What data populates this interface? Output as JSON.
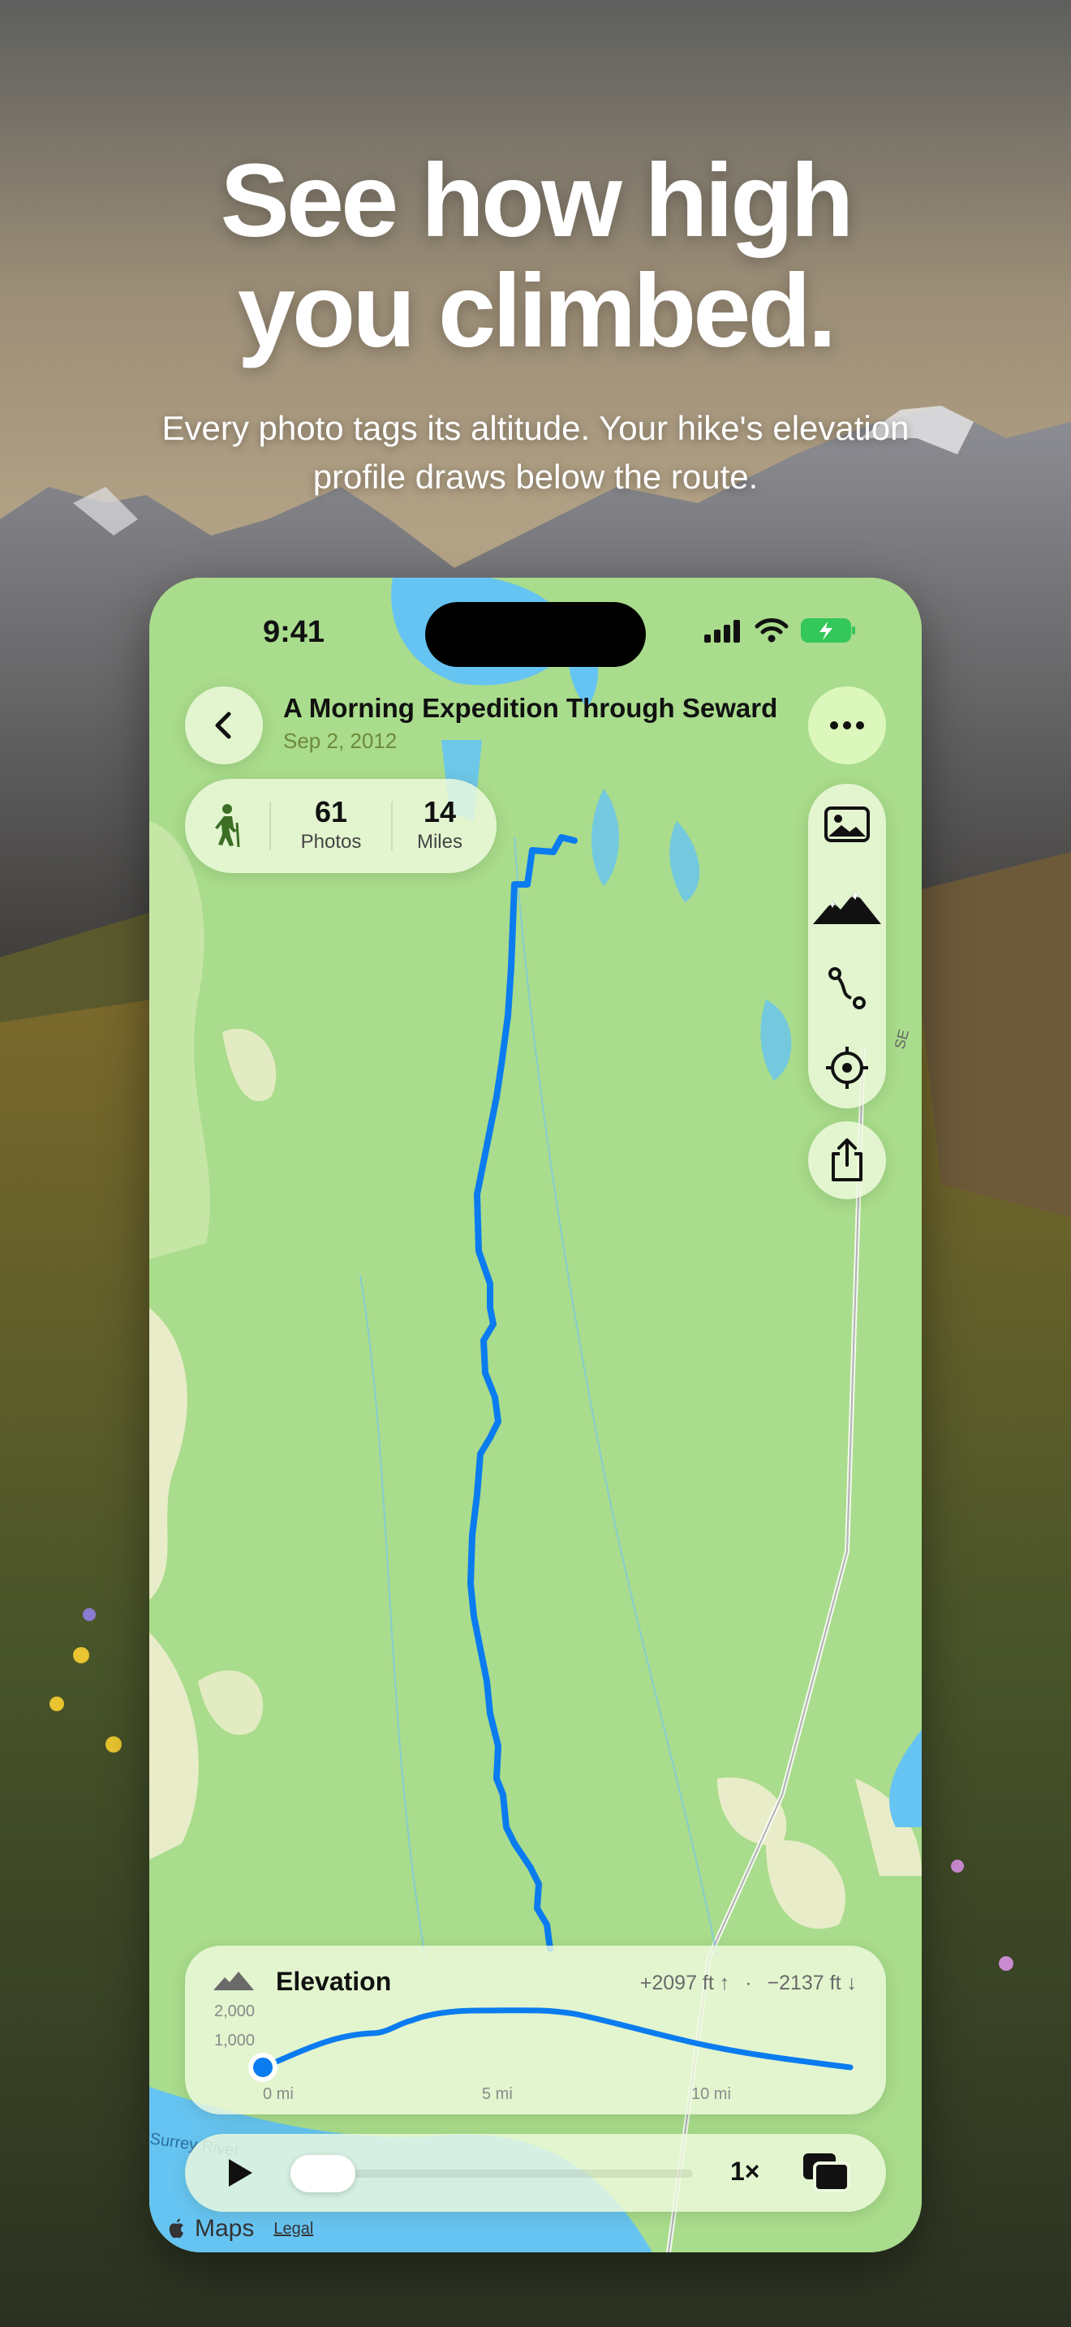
{
  "hero": {
    "headline_line1": "See how high",
    "headline_line2": "you climbed.",
    "subhead_line1": "Every photo tags its altitude. Your hike's elevation",
    "subhead_line2": "profile draws below the route."
  },
  "status_bar": {
    "time": "9:41"
  },
  "trip": {
    "title": "A Morning Expedition Through Seward",
    "date": "Sep 2, 2012"
  },
  "stats": {
    "photos_count": "61",
    "photos_label": "Photos",
    "miles_count": "14",
    "miles_label": "Miles"
  },
  "toolbar": {
    "icons": [
      "photo-icon",
      "mountains-icon",
      "route-icon",
      "locate-icon",
      "share-icon"
    ]
  },
  "elevation": {
    "title": "Elevation",
    "gain": "+2097 ft ↑",
    "separator": "·",
    "loss": "−2137 ft ↓",
    "y_tick_top": "2,000",
    "y_tick_mid": "1,000",
    "x_tick_start": "0 mi",
    "x_tick_mid": "5 mi",
    "x_tick_end": "10 mi",
    "playhead_fraction": 0.0
  },
  "player": {
    "speed": "1×",
    "scrub_position": 0.0
  },
  "map": {
    "road_label": "Surrey River",
    "highway_label": "SE"
  },
  "attribution": {
    "maps": "Maps",
    "legal": "Legal"
  },
  "colors": {
    "route": "#0a7cf0",
    "map_green": "#a9dc8c",
    "accent_green": "#dcf7bb",
    "water": "#66c4f2"
  }
}
